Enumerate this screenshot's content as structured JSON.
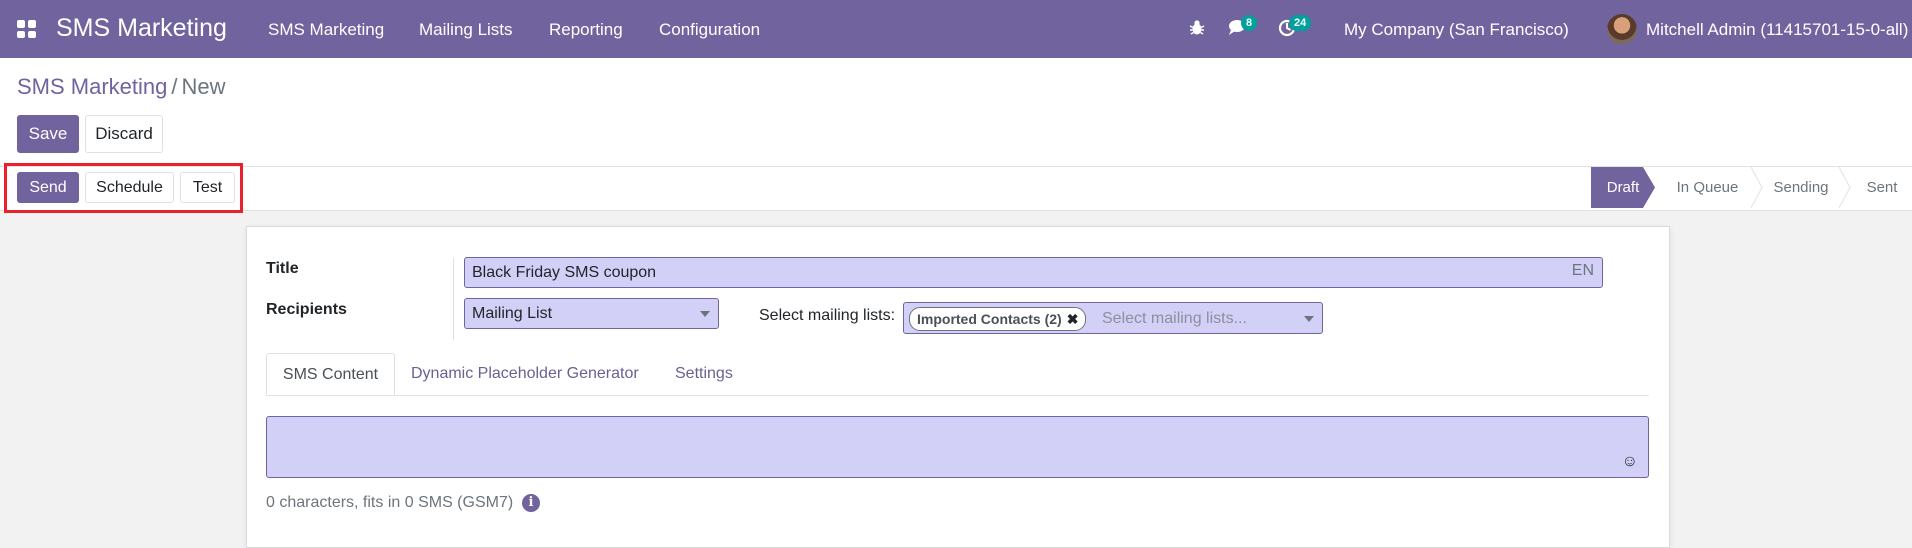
{
  "topbar": {
    "brand": "SMS Marketing",
    "menu": [
      "SMS Marketing",
      "Mailing Lists",
      "Reporting",
      "Configuration"
    ],
    "icons": {
      "apps": "grid-icon",
      "debug": "bug-icon",
      "chat": "chat-icon",
      "activity": "clock-icon"
    },
    "chat_badge": "8",
    "activity_badge": "24",
    "company": "My Company (San Francisco)",
    "user": "Mitchell Admin (11415701-15-0-all)"
  },
  "breadcrumb": {
    "parent": "SMS Marketing",
    "separator": "/",
    "current": "New"
  },
  "actions": {
    "save": "Save",
    "discard": "Discard"
  },
  "status_buttons": {
    "send": "Send",
    "schedule": "Schedule",
    "test": "Test"
  },
  "stages": [
    "Draft",
    "In Queue",
    "Sending",
    "Sent"
  ],
  "active_stage": "Draft",
  "form": {
    "title_label": "Title",
    "title_value": "Black Friday SMS coupon",
    "lang": "EN",
    "recipients_label": "Recipients",
    "recipients_value": "Mailing List",
    "mailing_lists_label": "Select mailing lists:",
    "mailing_list_tag": "Imported Contacts (2)",
    "mailing_lists_placeholder": "Select mailing lists..."
  },
  "tabs": [
    "SMS Content",
    "Dynamic Placeholder Generator",
    "Settings"
  ],
  "sms_counter": "0 characters, fits in 0 SMS (GSM7)",
  "colors": {
    "brand": "#71639e",
    "badge": "#00a09d",
    "highlight": "#e8212a",
    "field_bg": "#d3d0f7"
  }
}
